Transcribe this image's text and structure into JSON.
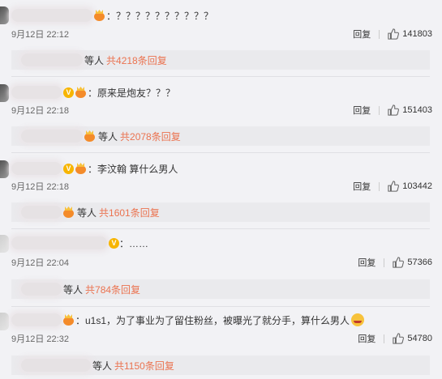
{
  "comments": [
    {
      "text": "：？？？？？？？？？？",
      "time": "9月12日 22:12",
      "reply_label": "回复",
      "likes": "141803",
      "sub": {
        "who": "等人",
        "count": "共4218条回复"
      }
    },
    {
      "text": "：原来是炮友？？？",
      "time": "9月12日 22:18",
      "reply_label": "回复",
      "likes": "151403",
      "sub": {
        "who": "等人",
        "count": "共2078条回复"
      }
    },
    {
      "text": "：李汶翰  算什么男人",
      "time": "9月12日 22:18",
      "reply_label": "回复",
      "likes": "103442",
      "sub": {
        "who": "等人",
        "count": "共1601条回复"
      }
    },
    {
      "text": "：……",
      "time": "9月12日 22:04",
      "reply_label": "回复",
      "likes": "57366",
      "sub": {
        "who": "等人",
        "count": "共784条回复"
      }
    },
    {
      "text": "：u1s1，为了事业为了留住粉丝，被曝光了就分手，算什么男人",
      "time": "9月12日 22:32",
      "reply_label": "回复",
      "likes": "54780",
      "sub": {
        "who": "等人",
        "count": "共1150条回复"
      }
    }
  ],
  "icons": {
    "like": "thumbs-up-icon",
    "vip": "vip-badge-icon",
    "crown": "crown-badge-icon"
  },
  "colors": {
    "accent": "#eb7350",
    "background": "#f2f2f5"
  }
}
